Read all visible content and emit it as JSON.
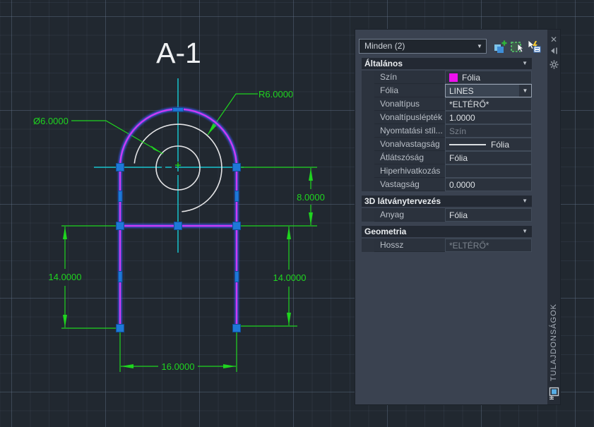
{
  "canvas": {
    "title": "A-1",
    "dims": {
      "radius": "R6.0000",
      "diameter": "Ø6.0000",
      "upper_height": "8.0000",
      "left_height": "14.0000",
      "right_height": "14.0000",
      "width": "16.0000"
    },
    "colors": {
      "selection_magenta": "#ce3af4",
      "selection_glow_blue": "#3c55ee",
      "dimension_green": "#1fd41f",
      "centerline_cyan": "#17c2cc",
      "grip_blue": "#1e78d7",
      "circle_white": "#e4e4e6"
    }
  },
  "panel": {
    "selector_value": "Minden (2)",
    "icons": {
      "combobox_arrow": "▼",
      "section_chevron": "▼",
      "close": "✕",
      "toolbar": [
        "toggle-pickadd-icon",
        "select-objects-icon",
        "quick-select-icon"
      ]
    },
    "sections": [
      {
        "title": "Általános",
        "rows": [
          {
            "label": "Szín",
            "value": "Fólia",
            "swatch_color": "#ee10ee"
          },
          {
            "label": "Fólia",
            "value": "LINES"
          },
          {
            "label": "Vonaltípus",
            "value": "*ELTÉRŐ*"
          },
          {
            "label": "Vonaltípuslépték",
            "value": "1.0000"
          },
          {
            "label": "Nyomtatási stíl...",
            "value": "Szín"
          },
          {
            "label": "Vonalvastagság",
            "value": "Fólia"
          },
          {
            "label": "Átlátszóság",
            "value": "Fólia"
          },
          {
            "label": "Hiperhivatkozás",
            "value": ""
          },
          {
            "label": "Vastagság",
            "value": "0.0000"
          }
        ]
      },
      {
        "title": "3D látványtervezés",
        "rows": [
          {
            "label": "Anyag",
            "value": "Fólia"
          }
        ]
      },
      {
        "title": "Geometria",
        "rows": [
          {
            "label": "Hossz",
            "value": "*ELTÉRŐ*"
          }
        ]
      }
    ],
    "tab_title": "TULAJDONSÁGOK"
  }
}
